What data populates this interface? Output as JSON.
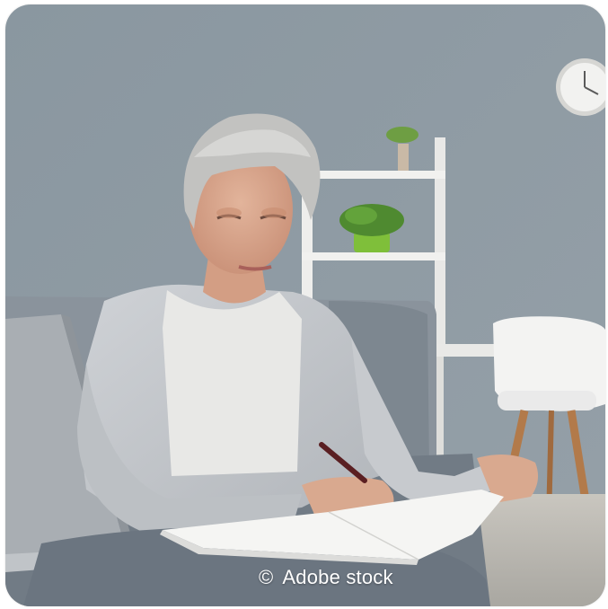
{
  "photo": {
    "subject": "photo-woman-writing-notes",
    "colors": {
      "wall": "#8e9aa3",
      "sofa": "#8b949d",
      "floor": "#b9b7b0",
      "shelf": "#f1f1ef",
      "chair": "#f4f4f4",
      "chair_legs": "#b27a4a",
      "plant": "#5d9a3a",
      "hair": "#bdbdbb",
      "skin": "#d9a98f",
      "cardigan": "#c3c6ca",
      "tshirt": "#e6e6e4",
      "laptop": "#aeb3b8",
      "notebook": "#f7f7f5",
      "pants": "#6c7680"
    }
  },
  "credit": {
    "symbol": "©",
    "text": "Adobe stock"
  }
}
